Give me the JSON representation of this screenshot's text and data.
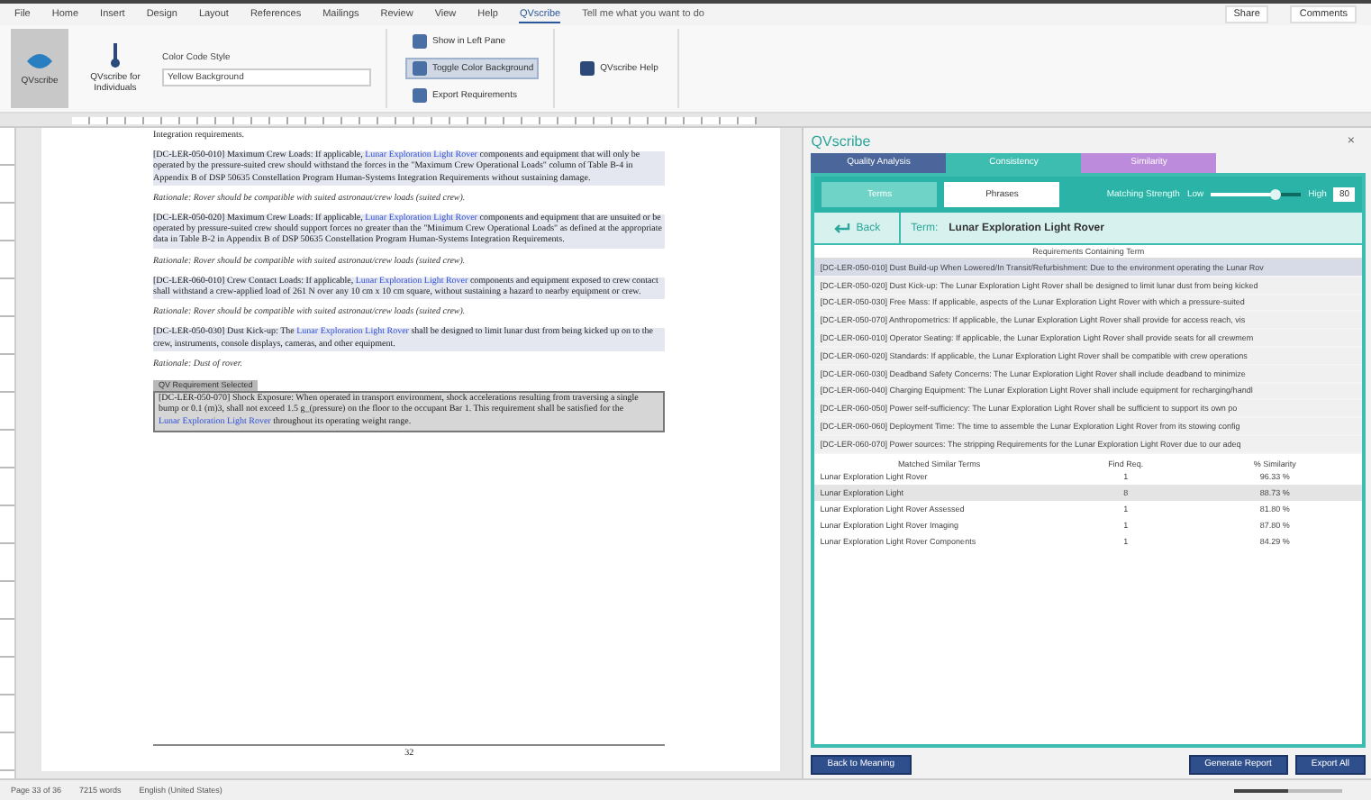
{
  "ribbon": {
    "tabs": [
      {
        "label": "File",
        "selected": false
      },
      {
        "label": "Home",
        "selected": false
      },
      {
        "label": "Insert",
        "selected": false
      },
      {
        "label": "Design",
        "selected": false
      },
      {
        "label": "Layout",
        "selected": false
      },
      {
        "label": "References",
        "selected": false
      },
      {
        "label": "Mailings",
        "selected": false
      },
      {
        "label": "Review",
        "selected": false
      },
      {
        "label": "View",
        "selected": false
      },
      {
        "label": "Help",
        "selected": false
      },
      {
        "label": "QVscribe",
        "selected": true
      }
    ],
    "search_hint": "Tell me what you want to do",
    "share": "Share",
    "comments": "Comments",
    "main_button": "QVscribe",
    "individuals": "QVscribe for Individuals",
    "color_label": "Color Code Style",
    "color_value": "Yellow Background",
    "actions": [
      {
        "label": "Show in Left Pane",
        "selected": false
      },
      {
        "label": "Toggle Color Background",
        "selected": true
      },
      {
        "label": "Export Requirements",
        "selected": false
      }
    ],
    "help": "QVscribe Help"
  },
  "document": {
    "paragraphs": [
      {
        "kind": "plain",
        "text": "Integration requirements."
      },
      {
        "kind": "requirement",
        "before": "[DC-LER-050-010] Maximum Crew Loads: If applicable, ",
        "link": "Lunar Exploration Light Rover",
        "after": " components and equipment that will only be operated by the pressure-suited crew should withstand the forces in the \"Maximum Crew Operational Loads\" column of Table B-4 in Appendix B of DSP 50635 Constellation Program Human-Systems Integration Requirements without sustaining damage."
      },
      {
        "kind": "rationale",
        "text": "Rationale: Rover should be compatible with suited astronaut/crew loads (suited crew)."
      },
      {
        "kind": "requirement",
        "before": "[DC-LER-050-020] Maximum Crew Loads: If applicable, ",
        "link": "Lunar Exploration Light Rover",
        "after": " components and equipment that are unsuited or be operated by pressure-suited crew should support forces no greater than the \"Minimum Crew Operational Loads\" as defined at the appropriate data in Table B-2 in Appendix B of DSP 50635 Constellation Program Human-Systems Integration Requirements."
      },
      {
        "kind": "rationale",
        "text": "Rationale: Rover should be compatible with suited astronaut/crew loads (suited crew)."
      },
      {
        "kind": "requirement",
        "before": "[DC-LER-060-010] Crew Contact Loads: If applicable, ",
        "link": "Lunar Exploration Light Rover",
        "after": " components and equipment exposed to crew contact shall withstand a crew-applied load of 261 N over any 10 cm x 10 cm square, without sustaining a hazard to nearby equipment or crew."
      },
      {
        "kind": "rationale",
        "text": "Rationale: Rover should be compatible with suited astronaut/crew loads (suited crew)."
      },
      {
        "kind": "requirement",
        "before": "[DC-LER-050-030] Dust Kick-up: The ",
        "link": "Lunar Exploration Light Rover",
        "after": " shall be designed to limit lunar dust from being kicked up on to the crew, instruments, console displays, cameras, and other equipment."
      },
      {
        "kind": "rationale",
        "text": "Rationale: Dust of rover."
      },
      {
        "kind": "selected",
        "tag": "QV Requirement Selected",
        "before": "[DC-LER-050-070] Shock Exposure: When operated in transport environment, shock accelerations resulting from traversing a single bump or 0.1 (m)3, shall not exceed 1.5 g_(pressure) on the floor to the occupant Bar 1. This requirement shall be satisfied for the ",
        "link": "Lunar Exploration Light Rover",
        "after": " throughout its operating weight range."
      }
    ],
    "page_number": "32"
  },
  "panel": {
    "title": "QVscribe",
    "close": "×",
    "tabs": [
      {
        "label": "Quality Analysis",
        "kind": "quality",
        "selected": false
      },
      {
        "label": "Consistency",
        "kind": "consistency",
        "selected": true
      },
      {
        "label": "Similarity",
        "kind": "similarity",
        "selected": false
      }
    ],
    "modes": [
      {
        "label": "Terms",
        "selected": false
      },
      {
        "label": "Phrases",
        "selected": true
      }
    ],
    "strength_label": "Matching Strength",
    "low": "Low",
    "high": "High",
    "strength": {
      "level": 0.72
    },
    "strength_value": "80",
    "back": "Back",
    "term_label": "Term:",
    "term": "Lunar Exploration Light Rover",
    "req_header": "Requirements Containing Term",
    "requirements": [
      {
        "text": "[DC-LER-050-010] Dust Build-up When Lowered/In Transit/Refurbishment: Due to the environment operating the Lunar Rov",
        "selected": true
      },
      {
        "text": "[DC-LER-050-020] Dust Kick-up: The Lunar Exploration Light Rover shall be designed to limit lunar dust from being kicked",
        "selected": false
      },
      {
        "text": "[DC-LER-050-030] Free Mass: If applicable, aspects of the Lunar Exploration Light Rover with which a pressure-suited",
        "selected": false
      },
      {
        "text": "[DC-LER-050-070] Anthropometrics: If applicable, the Lunar Exploration Light Rover shall provide for access reach, vis",
        "selected": false
      },
      {
        "text": "[DC-LER-060-010] Operator Seating: If applicable, the Lunar Exploration Light Rover shall provide seats for all crewmem",
        "selected": false
      },
      {
        "text": "[DC-LER-060-020] Standards: If applicable, the Lunar Exploration Light Rover shall be compatible with crew operations",
        "selected": false
      },
      {
        "text": "[DC-LER-060-030] Deadband Safety Concerns: The Lunar Exploration Light Rover shall include deadband to minimize",
        "selected": false
      },
      {
        "text": "[DC-LER-060-040] Charging Equipment: The Lunar Exploration Light Rover shall include equipment for recharging/handl",
        "selected": false
      },
      {
        "text": "[DC-LER-060-050] Power self-sufficiency: The Lunar Exploration Light Rover shall be sufficient to support its own po",
        "selected": false
      },
      {
        "text": "[DC-LER-060-060] Deployment Time: The time to assemble the Lunar Exploration Light Rover from its stowing config",
        "selected": false
      },
      {
        "text": "[DC-LER-060-070] Power sources: The stripping Requirements for the Lunar Exploration Light Rover due to our adeq",
        "selected": false
      }
    ],
    "sim_columns": [
      "Matched Similar Terms",
      "Find Req.",
      "% Similarity"
    ],
    "similar": [
      {
        "term": "Lunar Exploration Light Rover",
        "count": "1",
        "similarity": "96.33 %",
        "selected": false
      },
      {
        "term": "Lunar Exploration Light",
        "count": "8",
        "similarity": "88.73 %",
        "selected": true
      },
      {
        "term": "Lunar Exploration Light Rover Assessed",
        "count": "1",
        "similarity": "81.80 %",
        "selected": false
      },
      {
        "term": "Lunar Exploration Light Rover Imaging",
        "count": "1",
        "similarity": "87.80 %",
        "selected": false
      },
      {
        "term": "Lunar Exploration Light Rover Components",
        "count": "1",
        "similarity": "84.29 %",
        "selected": false
      }
    ],
    "left_button": "Back to Meaning",
    "right_buttons": [
      "Generate Report",
      "Export All"
    ]
  },
  "status_bar": [
    "Page 33 of 36",
    "7215 words",
    "English (United States)"
  ],
  "zoom": {
    "level": 0.5
  }
}
